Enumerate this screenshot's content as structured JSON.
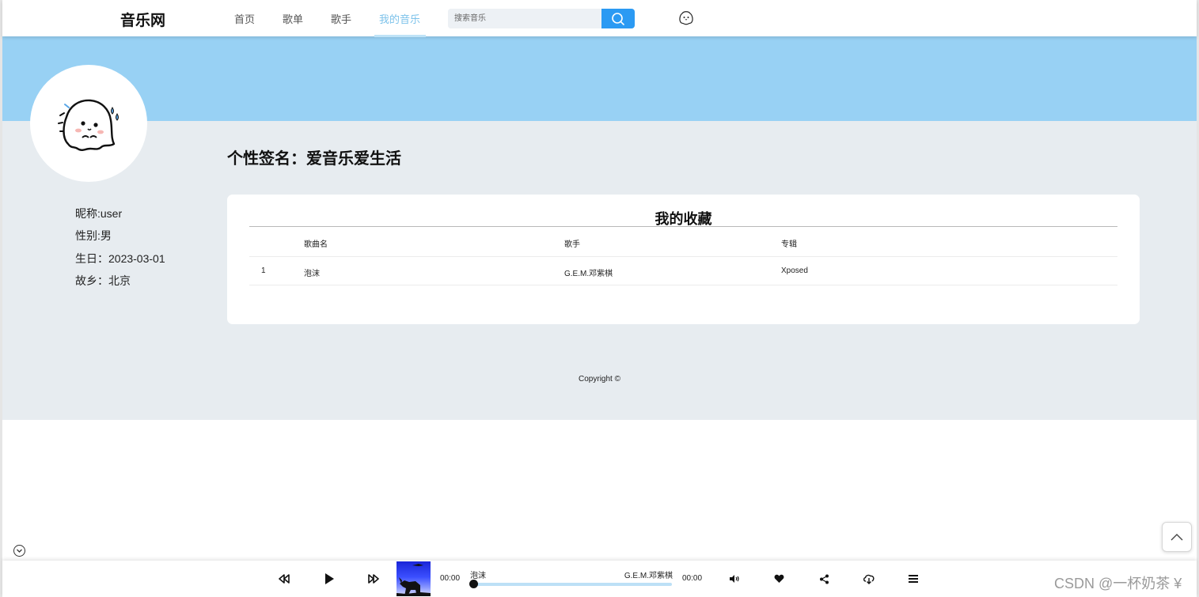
{
  "header": {
    "logo": "音乐网",
    "nav": [
      {
        "label": "首页"
      },
      {
        "label": "歌单"
      },
      {
        "label": "歌手"
      },
      {
        "label": "我的音乐",
        "active": true
      }
    ],
    "search": {
      "placeholder": "搜索音乐",
      "value": ""
    }
  },
  "profile": {
    "signature": "个性签名：爱音乐爱生活",
    "nickname": "昵称:user",
    "gender": "性别:男",
    "birthday": "生日：2023-03-01",
    "hometown": "故乡：北京"
  },
  "favorites": {
    "title": "我的收藏",
    "columns": [
      "",
      "歌曲名",
      "歌手",
      "专辑"
    ],
    "rows": [
      {
        "index": "1",
        "song": "泡沫",
        "singer": "G.E.M.邓紫棋",
        "album": "Xposed"
      }
    ]
  },
  "footer": {
    "copyright": "Copyright ©"
  },
  "player": {
    "current_time": "00:00",
    "total_time": "00:00",
    "song": "泡沫",
    "singer": "G.E.M.邓紫棋",
    "progress": 0
  },
  "watermark": "CSDN @一杯奶茶 ¥",
  "colors": {
    "banner": "#98d1f4",
    "content_bg": "#e7ecf0",
    "accent": "#2b9af3",
    "nav_active": "#7cc2ea"
  }
}
